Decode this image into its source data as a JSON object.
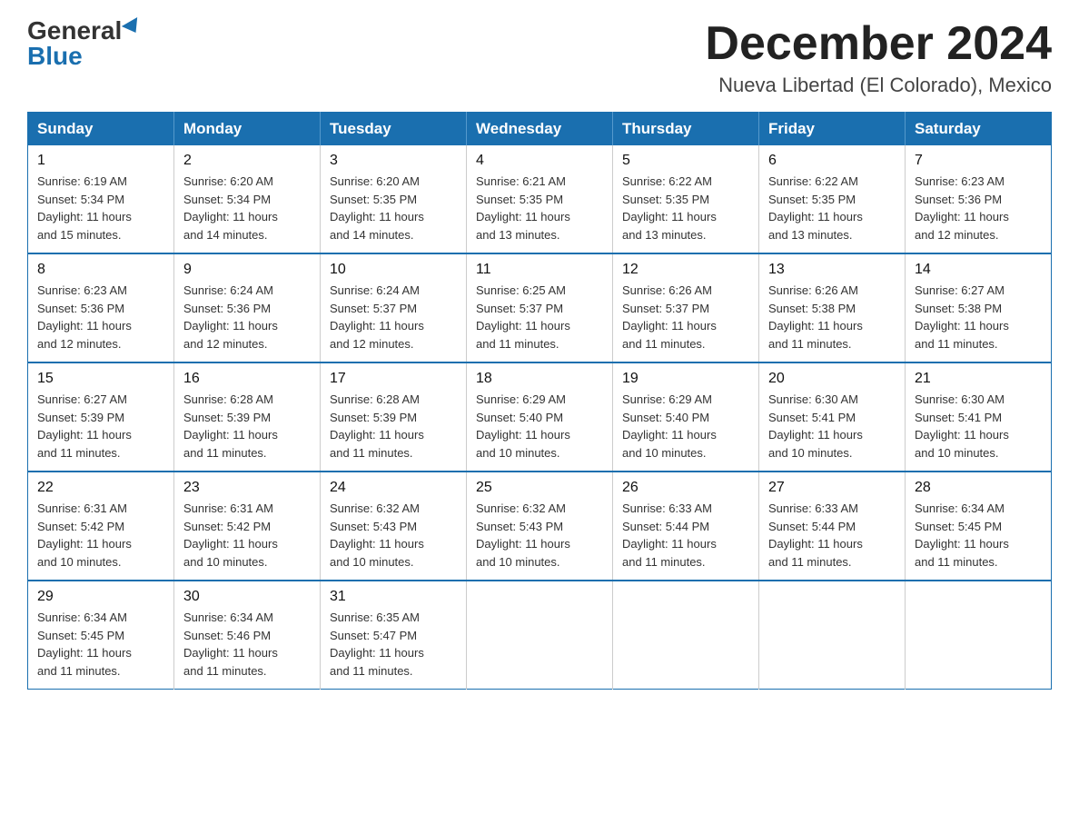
{
  "logo": {
    "general": "General",
    "blue": "Blue"
  },
  "header": {
    "month_year": "December 2024",
    "location": "Nueva Libertad (El Colorado), Mexico"
  },
  "days_of_week": [
    "Sunday",
    "Monday",
    "Tuesday",
    "Wednesday",
    "Thursday",
    "Friday",
    "Saturday"
  ],
  "weeks": [
    [
      {
        "day": "1",
        "sunrise": "6:19 AM",
        "sunset": "5:34 PM",
        "daylight": "11 hours and 15 minutes."
      },
      {
        "day": "2",
        "sunrise": "6:20 AM",
        "sunset": "5:34 PM",
        "daylight": "11 hours and 14 minutes."
      },
      {
        "day": "3",
        "sunrise": "6:20 AM",
        "sunset": "5:35 PM",
        "daylight": "11 hours and 14 minutes."
      },
      {
        "day": "4",
        "sunrise": "6:21 AM",
        "sunset": "5:35 PM",
        "daylight": "11 hours and 13 minutes."
      },
      {
        "day": "5",
        "sunrise": "6:22 AM",
        "sunset": "5:35 PM",
        "daylight": "11 hours and 13 minutes."
      },
      {
        "day": "6",
        "sunrise": "6:22 AM",
        "sunset": "5:35 PM",
        "daylight": "11 hours and 13 minutes."
      },
      {
        "day": "7",
        "sunrise": "6:23 AM",
        "sunset": "5:36 PM",
        "daylight": "11 hours and 12 minutes."
      }
    ],
    [
      {
        "day": "8",
        "sunrise": "6:23 AM",
        "sunset": "5:36 PM",
        "daylight": "11 hours and 12 minutes."
      },
      {
        "day": "9",
        "sunrise": "6:24 AM",
        "sunset": "5:36 PM",
        "daylight": "11 hours and 12 minutes."
      },
      {
        "day": "10",
        "sunrise": "6:24 AM",
        "sunset": "5:37 PM",
        "daylight": "11 hours and 12 minutes."
      },
      {
        "day": "11",
        "sunrise": "6:25 AM",
        "sunset": "5:37 PM",
        "daylight": "11 hours and 11 minutes."
      },
      {
        "day": "12",
        "sunrise": "6:26 AM",
        "sunset": "5:37 PM",
        "daylight": "11 hours and 11 minutes."
      },
      {
        "day": "13",
        "sunrise": "6:26 AM",
        "sunset": "5:38 PM",
        "daylight": "11 hours and 11 minutes."
      },
      {
        "day": "14",
        "sunrise": "6:27 AM",
        "sunset": "5:38 PM",
        "daylight": "11 hours and 11 minutes."
      }
    ],
    [
      {
        "day": "15",
        "sunrise": "6:27 AM",
        "sunset": "5:39 PM",
        "daylight": "11 hours and 11 minutes."
      },
      {
        "day": "16",
        "sunrise": "6:28 AM",
        "sunset": "5:39 PM",
        "daylight": "11 hours and 11 minutes."
      },
      {
        "day": "17",
        "sunrise": "6:28 AM",
        "sunset": "5:39 PM",
        "daylight": "11 hours and 11 minutes."
      },
      {
        "day": "18",
        "sunrise": "6:29 AM",
        "sunset": "5:40 PM",
        "daylight": "11 hours and 10 minutes."
      },
      {
        "day": "19",
        "sunrise": "6:29 AM",
        "sunset": "5:40 PM",
        "daylight": "11 hours and 10 minutes."
      },
      {
        "day": "20",
        "sunrise": "6:30 AM",
        "sunset": "5:41 PM",
        "daylight": "11 hours and 10 minutes."
      },
      {
        "day": "21",
        "sunrise": "6:30 AM",
        "sunset": "5:41 PM",
        "daylight": "11 hours and 10 minutes."
      }
    ],
    [
      {
        "day": "22",
        "sunrise": "6:31 AM",
        "sunset": "5:42 PM",
        "daylight": "11 hours and 10 minutes."
      },
      {
        "day": "23",
        "sunrise": "6:31 AM",
        "sunset": "5:42 PM",
        "daylight": "11 hours and 10 minutes."
      },
      {
        "day": "24",
        "sunrise": "6:32 AM",
        "sunset": "5:43 PM",
        "daylight": "11 hours and 10 minutes."
      },
      {
        "day": "25",
        "sunrise": "6:32 AM",
        "sunset": "5:43 PM",
        "daylight": "11 hours and 10 minutes."
      },
      {
        "day": "26",
        "sunrise": "6:33 AM",
        "sunset": "5:44 PM",
        "daylight": "11 hours and 11 minutes."
      },
      {
        "day": "27",
        "sunrise": "6:33 AM",
        "sunset": "5:44 PM",
        "daylight": "11 hours and 11 minutes."
      },
      {
        "day": "28",
        "sunrise": "6:34 AM",
        "sunset": "5:45 PM",
        "daylight": "11 hours and 11 minutes."
      }
    ],
    [
      {
        "day": "29",
        "sunrise": "6:34 AM",
        "sunset": "5:45 PM",
        "daylight": "11 hours and 11 minutes."
      },
      {
        "day": "30",
        "sunrise": "6:34 AM",
        "sunset": "5:46 PM",
        "daylight": "11 hours and 11 minutes."
      },
      {
        "day": "31",
        "sunrise": "6:35 AM",
        "sunset": "5:47 PM",
        "daylight": "11 hours and 11 minutes."
      },
      null,
      null,
      null,
      null
    ]
  ],
  "labels": {
    "sunrise": "Sunrise:",
    "sunset": "Sunset:",
    "daylight": "Daylight:"
  }
}
